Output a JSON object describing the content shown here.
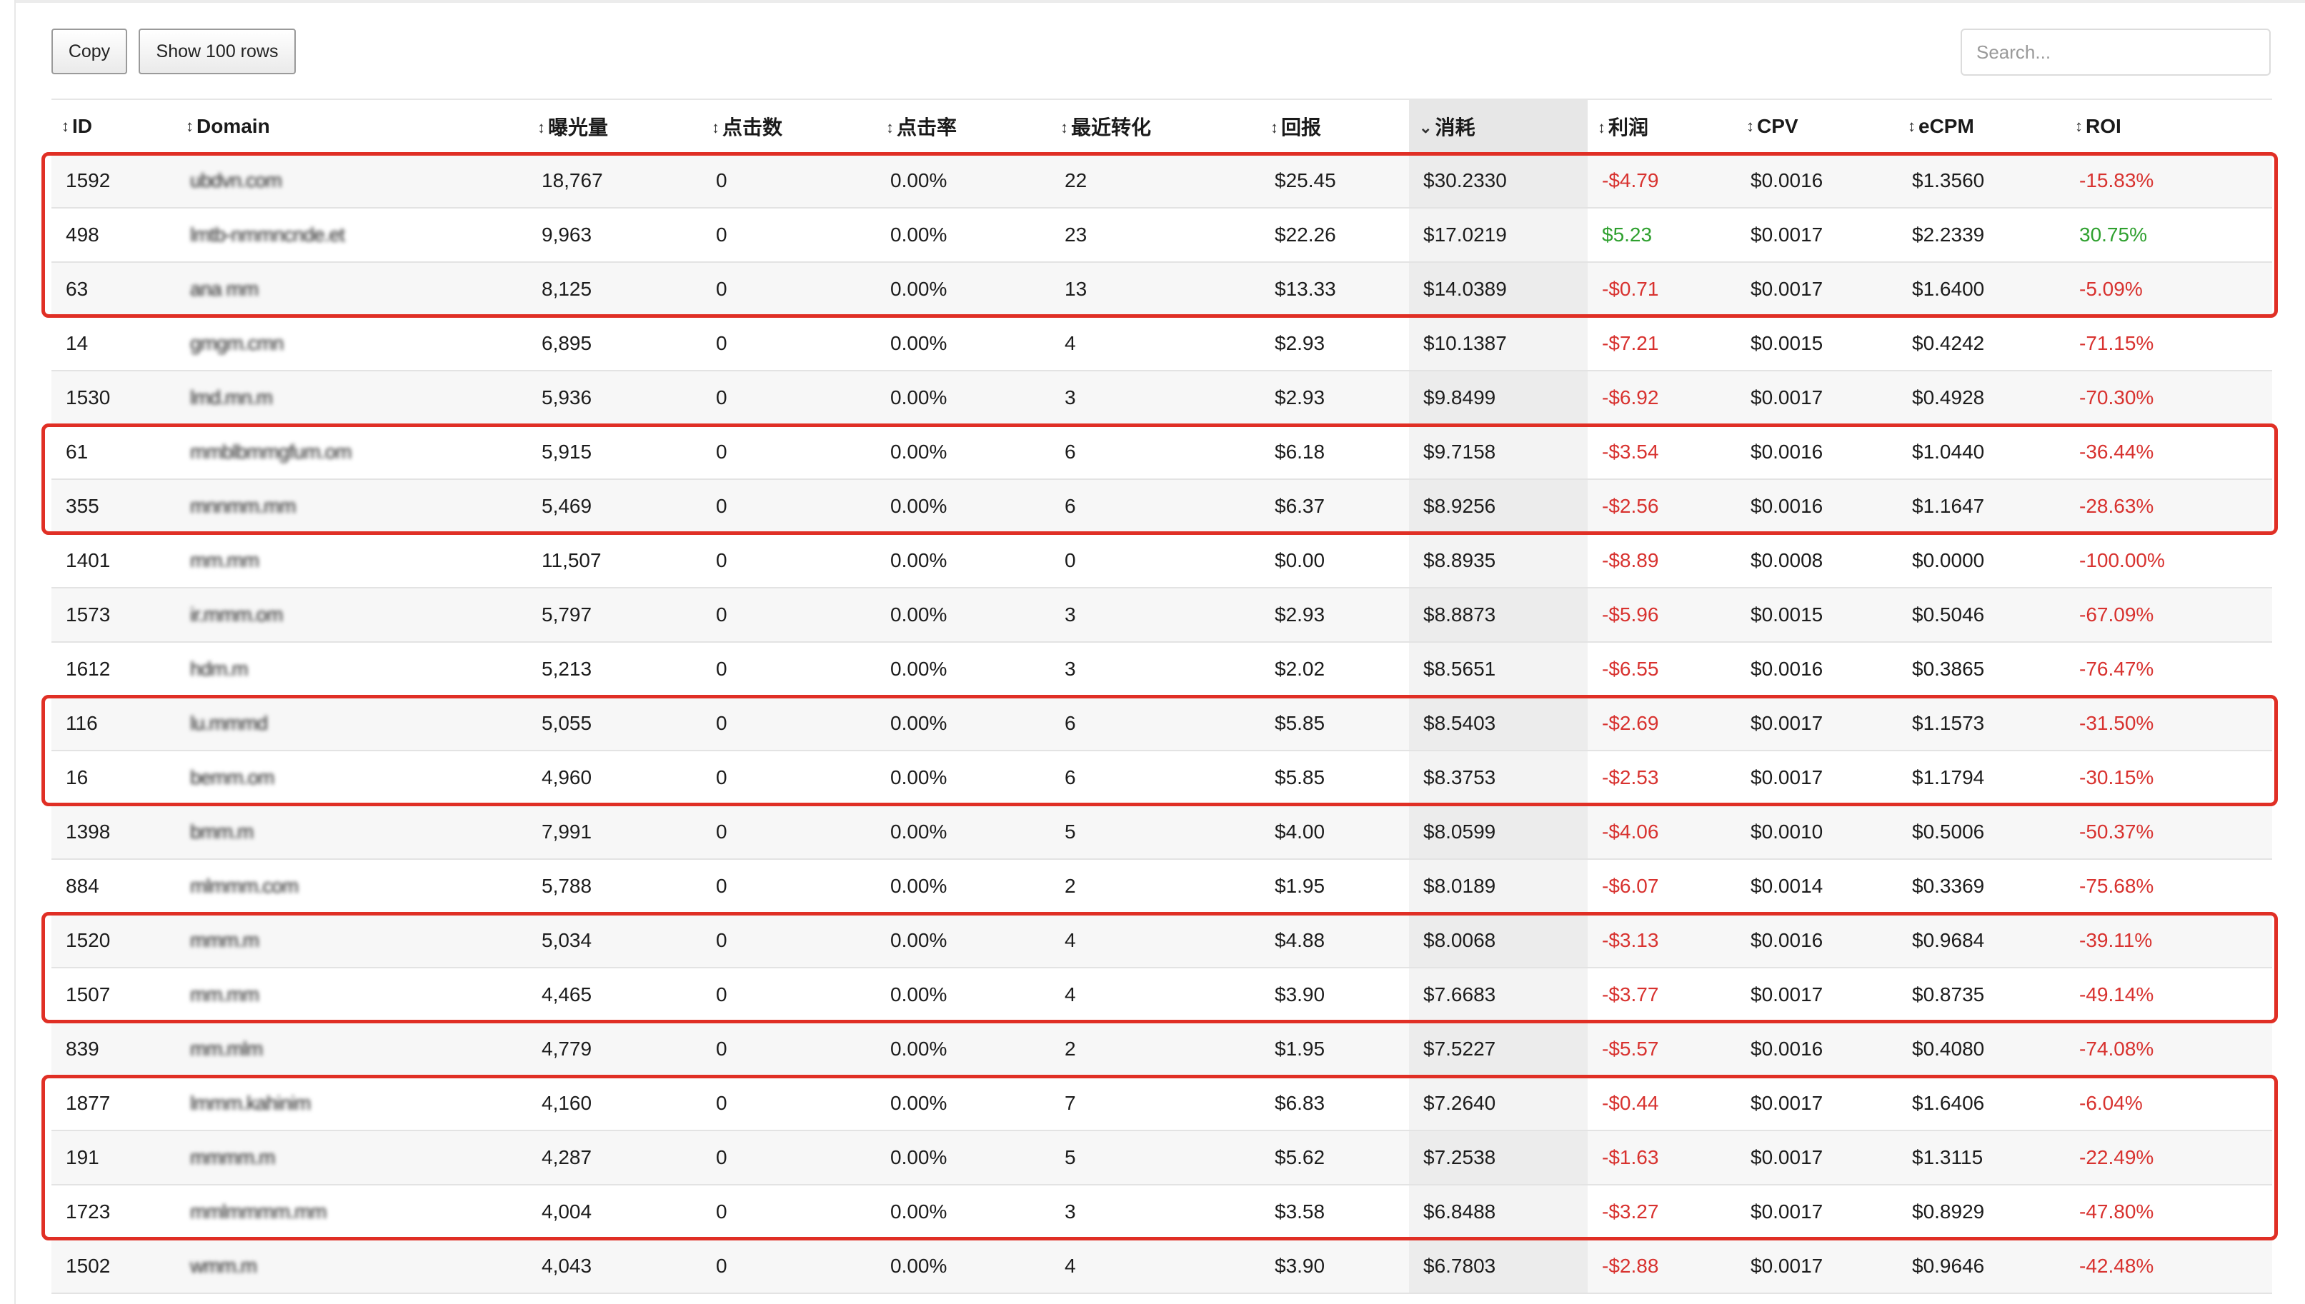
{
  "toolbar": {
    "copy_label": "Copy",
    "rows_label": "Show 100 rows"
  },
  "search": {
    "placeholder": "Search...",
    "value": ""
  },
  "table": {
    "sorted_column": "消耗",
    "columns": [
      {
        "key": "id",
        "label": "ID",
        "sort_icon": "sort-both-icon"
      },
      {
        "key": "domain",
        "label": "Domain",
        "sort_icon": "sort-both-icon"
      },
      {
        "key": "impressions",
        "label": "曝光量",
        "sort_icon": "sort-both-icon"
      },
      {
        "key": "clicks",
        "label": "点击数",
        "sort_icon": "sort-both-icon"
      },
      {
        "key": "ctr",
        "label": "点击率",
        "sort_icon": "sort-both-icon"
      },
      {
        "key": "conversions",
        "label": "最近转化",
        "sort_icon": "sort-both-icon"
      },
      {
        "key": "revenue",
        "label": "回报",
        "sort_icon": "sort-both-icon"
      },
      {
        "key": "spend",
        "label": "消耗",
        "sort_icon": "sort-desc-icon"
      },
      {
        "key": "profit",
        "label": "利润",
        "sort_icon": "sort-both-icon"
      },
      {
        "key": "cpv",
        "label": "CPV",
        "sort_icon": "sort-both-icon"
      },
      {
        "key": "ecpm",
        "label": "eCPM",
        "sort_icon": "sort-both-icon"
      },
      {
        "key": "roi",
        "label": "ROI",
        "sort_icon": "sort-both-icon"
      }
    ],
    "rows": [
      {
        "id": "1592",
        "domain": "ubdvn.com",
        "impressions": "18,767",
        "clicks": "0",
        "ctr": "0.00%",
        "conversions": "22",
        "revenue": "$25.45",
        "spend": "$30.2330",
        "profit": "-$4.79",
        "cpv": "$0.0016",
        "ecpm": "$1.3560",
        "roi": "-15.83%"
      },
      {
        "id": "498",
        "domain": "lmtb-nmmncnde.et",
        "impressions": "9,963",
        "clicks": "0",
        "ctr": "0.00%",
        "conversions": "23",
        "revenue": "$22.26",
        "spend": "$17.0219",
        "profit": "$5.23",
        "cpv": "$0.0017",
        "ecpm": "$2.2339",
        "roi": "30.75%"
      },
      {
        "id": "63",
        "domain": "ana mm",
        "impressions": "8,125",
        "clicks": "0",
        "ctr": "0.00%",
        "conversions": "13",
        "revenue": "$13.33",
        "spend": "$14.0389",
        "profit": "-$0.71",
        "cpv": "$0.0017",
        "ecpm": "$1.6400",
        "roi": "-5.09%"
      },
      {
        "id": "14",
        "domain": "gmgm.cmn",
        "impressions": "6,895",
        "clicks": "0",
        "ctr": "0.00%",
        "conversions": "4",
        "revenue": "$2.93",
        "spend": "$10.1387",
        "profit": "-$7.21",
        "cpv": "$0.0015",
        "ecpm": "$0.4242",
        "roi": "-71.15%"
      },
      {
        "id": "1530",
        "domain": "lmd.mn.m",
        "impressions": "5,936",
        "clicks": "0",
        "ctr": "0.00%",
        "conversions": "3",
        "revenue": "$2.93",
        "spend": "$9.8499",
        "profit": "-$6.92",
        "cpv": "$0.0017",
        "ecpm": "$0.4928",
        "roi": "-70.30%"
      },
      {
        "id": "61",
        "domain": "mmblbmmgfum.om",
        "impressions": "5,915",
        "clicks": "0",
        "ctr": "0.00%",
        "conversions": "6",
        "revenue": "$6.18",
        "spend": "$9.7158",
        "profit": "-$3.54",
        "cpv": "$0.0016",
        "ecpm": "$1.0440",
        "roi": "-36.44%"
      },
      {
        "id": "355",
        "domain": "mnnmm.mm",
        "impressions": "5,469",
        "clicks": "0",
        "ctr": "0.00%",
        "conversions": "6",
        "revenue": "$6.37",
        "spend": "$8.9256",
        "profit": "-$2.56",
        "cpv": "$0.0016",
        "ecpm": "$1.1647",
        "roi": "-28.63%"
      },
      {
        "id": "1401",
        "domain": "mm.mm",
        "impressions": "11,507",
        "clicks": "0",
        "ctr": "0.00%",
        "conversions": "0",
        "revenue": "$0.00",
        "spend": "$8.8935",
        "profit": "-$8.89",
        "cpv": "$0.0008",
        "ecpm": "$0.0000",
        "roi": "-100.00%"
      },
      {
        "id": "1573",
        "domain": "ir.mmm.om",
        "impressions": "5,797",
        "clicks": "0",
        "ctr": "0.00%",
        "conversions": "3",
        "revenue": "$2.93",
        "spend": "$8.8873",
        "profit": "-$5.96",
        "cpv": "$0.0015",
        "ecpm": "$0.5046",
        "roi": "-67.09%"
      },
      {
        "id": "1612",
        "domain": "hdm.m",
        "impressions": "5,213",
        "clicks": "0",
        "ctr": "0.00%",
        "conversions": "3",
        "revenue": "$2.02",
        "spend": "$8.5651",
        "profit": "-$6.55",
        "cpv": "$0.0016",
        "ecpm": "$0.3865",
        "roi": "-76.47%"
      },
      {
        "id": "116",
        "domain": "lu.mmmd",
        "impressions": "5,055",
        "clicks": "0",
        "ctr": "0.00%",
        "conversions": "6",
        "revenue": "$5.85",
        "spend": "$8.5403",
        "profit": "-$2.69",
        "cpv": "$0.0017",
        "ecpm": "$1.1573",
        "roi": "-31.50%"
      },
      {
        "id": "16",
        "domain": "bemm.om",
        "impressions": "4,960",
        "clicks": "0",
        "ctr": "0.00%",
        "conversions": "6",
        "revenue": "$5.85",
        "spend": "$8.3753",
        "profit": "-$2.53",
        "cpv": "$0.0017",
        "ecpm": "$1.1794",
        "roi": "-30.15%"
      },
      {
        "id": "1398",
        "domain": "bmm.m",
        "impressions": "7,991",
        "clicks": "0",
        "ctr": "0.00%",
        "conversions": "5",
        "revenue": "$4.00",
        "spend": "$8.0599",
        "profit": "-$4.06",
        "cpv": "$0.0010",
        "ecpm": "$0.5006",
        "roi": "-50.37%"
      },
      {
        "id": "884",
        "domain": "mlmmm.com",
        "impressions": "5,788",
        "clicks": "0",
        "ctr": "0.00%",
        "conversions": "2",
        "revenue": "$1.95",
        "spend": "$8.0189",
        "profit": "-$6.07",
        "cpv": "$0.0014",
        "ecpm": "$0.3369",
        "roi": "-75.68%"
      },
      {
        "id": "1520",
        "domain": "mmm.m",
        "impressions": "5,034",
        "clicks": "0",
        "ctr": "0.00%",
        "conversions": "4",
        "revenue": "$4.88",
        "spend": "$8.0068",
        "profit": "-$3.13",
        "cpv": "$0.0016",
        "ecpm": "$0.9684",
        "roi": "-39.11%"
      },
      {
        "id": "1507",
        "domain": "mm.mm",
        "impressions": "4,465",
        "clicks": "0",
        "ctr": "0.00%",
        "conversions": "4",
        "revenue": "$3.90",
        "spend": "$7.6683",
        "profit": "-$3.77",
        "cpv": "$0.0017",
        "ecpm": "$0.8735",
        "roi": "-49.14%"
      },
      {
        "id": "839",
        "domain": "mm.mlm",
        "impressions": "4,779",
        "clicks": "0",
        "ctr": "0.00%",
        "conversions": "2",
        "revenue": "$1.95",
        "spend": "$7.5227",
        "profit": "-$5.57",
        "cpv": "$0.0016",
        "ecpm": "$0.4080",
        "roi": "-74.08%"
      },
      {
        "id": "1877",
        "domain": "lmmm.kahinim",
        "impressions": "4,160",
        "clicks": "0",
        "ctr": "0.00%",
        "conversions": "7",
        "revenue": "$6.83",
        "spend": "$7.2640",
        "profit": "-$0.44",
        "cpv": "$0.0017",
        "ecpm": "$1.6406",
        "roi": "-6.04%"
      },
      {
        "id": "191",
        "domain": "mmmm.m",
        "impressions": "4,287",
        "clicks": "0",
        "ctr": "0.00%",
        "conversions": "5",
        "revenue": "$5.62",
        "spend": "$7.2538",
        "profit": "-$1.63",
        "cpv": "$0.0017",
        "ecpm": "$1.3115",
        "roi": "-22.49%"
      },
      {
        "id": "1723",
        "domain": "mmlmmmm.mm",
        "impressions": "4,004",
        "clicks": "0",
        "ctr": "0.00%",
        "conversions": "3",
        "revenue": "$3.58",
        "spend": "$6.8488",
        "profit": "-$3.27",
        "cpv": "$0.0017",
        "ecpm": "$0.8929",
        "roi": "-47.80%"
      },
      {
        "id": "1502",
        "domain": "wmm.m",
        "impressions": "4,043",
        "clicks": "0",
        "ctr": "0.00%",
        "conversions": "4",
        "revenue": "$3.90",
        "spend": "$6.7803",
        "profit": "-$2.88",
        "cpv": "$0.0017",
        "ecpm": "$0.9646",
        "roi": "-42.48%"
      }
    ]
  },
  "highlight_groups": [
    {
      "row_ids": [
        "1592",
        "498",
        "63"
      ]
    },
    {
      "row_ids": [
        "61",
        "355"
      ]
    },
    {
      "row_ids": [
        "116",
        "16"
      ]
    },
    {
      "row_ids": [
        "1520",
        "1507"
      ]
    },
    {
      "row_ids": [
        "1877",
        "191",
        "1723"
      ]
    }
  ],
  "colors": {
    "negative": "#d8322f",
    "positive": "#2ea02e",
    "highlight_border": "#e02f25"
  }
}
